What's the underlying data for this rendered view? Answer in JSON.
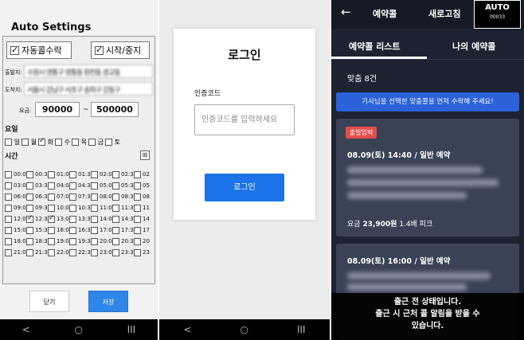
{
  "panel1": {
    "title": "Auto Settings",
    "auto_accept": {
      "label": "자동콜수락",
      "checked": true
    },
    "start_stop": {
      "label": "시작/중지",
      "checked": true
    },
    "departure_label": "출발지:",
    "departure_value": "수원시 영통구 영통동 원천동 광교동",
    "arrival_label": "도착지:",
    "arrival_value": "서울시 강남구 서초구 송파구 강동구",
    "fare_label": "요금:",
    "fare_min": "90000",
    "fare_sep": "~",
    "fare_max": "500000",
    "days_header": "요일",
    "days": [
      {
        "label": "일",
        "checked": false
      },
      {
        "label": "월",
        "checked": false
      },
      {
        "label": "화",
        "checked": true
      },
      {
        "label": "수",
        "checked": false
      },
      {
        "label": "목",
        "checked": false
      },
      {
        "label": "금",
        "checked": false
      },
      {
        "label": "토",
        "checked": false
      }
    ],
    "time_header": "시간",
    "times": [
      {
        "label": "00:00",
        "checked": false
      },
      {
        "label": "00:30",
        "checked": false
      },
      {
        "label": "01:00",
        "checked": false
      },
      {
        "label": "01:30",
        "checked": false
      },
      {
        "label": "02:00",
        "checked": false
      },
      {
        "label": "02:30",
        "checked": false
      },
      {
        "label": "02",
        "checked": false
      },
      {
        "label": "03:00",
        "checked": false
      },
      {
        "label": "03:30",
        "checked": false
      },
      {
        "label": "04:00",
        "checked": false
      },
      {
        "label": "04:30",
        "checked": false
      },
      {
        "label": "05:00",
        "checked": false
      },
      {
        "label": "05:30",
        "checked": false
      },
      {
        "label": "05",
        "checked": false
      },
      {
        "label": "06:00",
        "checked": false
      },
      {
        "label": "06:30",
        "checked": false
      },
      {
        "label": "07:00",
        "checked": false
      },
      {
        "label": "07:30",
        "checked": false
      },
      {
        "label": "08:00",
        "checked": false
      },
      {
        "label": "08:30",
        "checked": false
      },
      {
        "label": "08",
        "checked": false
      },
      {
        "label": "09:00",
        "checked": false
      },
      {
        "label": "09:30",
        "checked": false
      },
      {
        "label": "10:00",
        "checked": false
      },
      {
        "label": "10:30",
        "checked": false
      },
      {
        "label": "11:00",
        "checked": false
      },
      {
        "label": "11:30",
        "checked": false
      },
      {
        "label": "11",
        "checked": false
      },
      {
        "label": "12:00",
        "checked": false
      },
      {
        "label": "12:30",
        "checked": true
      },
      {
        "label": "13:00",
        "checked": true
      },
      {
        "label": "13:30",
        "checked": false
      },
      {
        "label": "14:00",
        "checked": false
      },
      {
        "label": "14:30",
        "checked": false
      },
      {
        "label": "14",
        "checked": false
      },
      {
        "label": "15:00",
        "checked": false
      },
      {
        "label": "15:30",
        "checked": false
      },
      {
        "label": "16:00",
        "checked": false
      },
      {
        "label": "16:30",
        "checked": false
      },
      {
        "label": "17:00",
        "checked": false
      },
      {
        "label": "17:30",
        "checked": false
      },
      {
        "label": "17",
        "checked": false
      },
      {
        "label": "18:00",
        "checked": false
      },
      {
        "label": "18:30",
        "checked": false
      },
      {
        "label": "19:00",
        "checked": false
      },
      {
        "label": "19:30",
        "checked": false
      },
      {
        "label": "20:00",
        "checked": false
      },
      {
        "label": "20:30",
        "checked": false
      },
      {
        "label": "20",
        "checked": false
      },
      {
        "label": "21:00",
        "checked": false
      },
      {
        "label": "21:30",
        "checked": false
      },
      {
        "label": "22:00",
        "checked": false
      },
      {
        "label": "22:30",
        "checked": false
      },
      {
        "label": "23:00",
        "checked": false
      },
      {
        "label": "23:30",
        "checked": false
      },
      {
        "label": "23",
        "checked": false
      }
    ],
    "close_label": "닫기",
    "save_label": "저장"
  },
  "panel2": {
    "title": "로그인",
    "code_label": "인증코드",
    "code_placeholder": "인증코드를 입력하세요",
    "login_label": "로그인"
  },
  "panel3": {
    "title": "예약콜",
    "refresh_label": "새로고침",
    "auto_label": "AUTO",
    "auto_code": "00033",
    "tabs": [
      "예약콜 리스트",
      "나의 예약콜"
    ],
    "match_count": "맞춤 8건",
    "notice": "기사님을 선택한 맞춤콜을 먼저 수락해 주세요!",
    "bookings": [
      {
        "badge": "출발임박",
        "datetime": "08.09(토) 14:40 / 일반 예약",
        "fare_label": "요금",
        "fare_value": "23,900원",
        "surge": "1.4배 피크"
      },
      {
        "datetime": "08.09(토) 16:00 / 일반 예약"
      }
    ],
    "overlay_text": "출근 전 상태입니다.\n출근 시 근처 콜 알림을 받을 수\n있습니다."
  },
  "nav": {
    "back": "<",
    "home": "○",
    "recent": "III"
  },
  "colors": {
    "primary_blue": "#1a73e8",
    "save_blue": "#2f86e8",
    "notice_blue": "#2b61d9",
    "badge_red": "#e24c4c",
    "dark_bg": "#1d2331",
    "card_bg": "#3a4255"
  }
}
